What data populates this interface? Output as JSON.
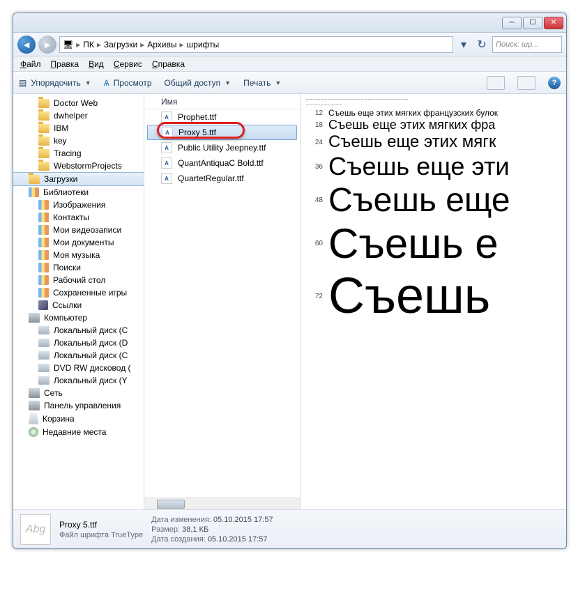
{
  "breadcrumb": {
    "pc": "ПК",
    "downloads": "Загрузки",
    "archives": "Архивы",
    "fonts": "шрифты"
  },
  "search": {
    "placeholder": "Поиск: шр..."
  },
  "menu": {
    "file": "Файл",
    "edit": "Правка",
    "view": "Вид",
    "tools": "Сервис",
    "help": "Справка"
  },
  "toolbar": {
    "organize": "Упорядочить",
    "preview": "Просмотр",
    "share": "Общий доступ",
    "print": "Печать"
  },
  "sidebar": {
    "items": [
      {
        "label": "Doctor Web",
        "icon": "f",
        "lvl": 2
      },
      {
        "label": "dwhelper",
        "icon": "f",
        "lvl": 2
      },
      {
        "label": "IBM",
        "icon": "f",
        "lvl": 2
      },
      {
        "label": "key",
        "icon": "f",
        "lvl": 2
      },
      {
        "label": "Tracing",
        "icon": "f",
        "lvl": 2
      },
      {
        "label": "WebstormProjects",
        "icon": "f",
        "lvl": 2
      },
      {
        "label": "Загрузки",
        "icon": "f",
        "lvl": 1,
        "sel": true
      },
      {
        "label": "Библиотеки",
        "icon": "lib",
        "lvl": 1
      },
      {
        "label": "Изображения",
        "icon": "lib",
        "lvl": 2
      },
      {
        "label": "Контакты",
        "icon": "lib",
        "lvl": 2
      },
      {
        "label": "Мои видеозаписи",
        "icon": "lib",
        "lvl": 2
      },
      {
        "label": "Мои документы",
        "icon": "lib",
        "lvl": 2
      },
      {
        "label": "Моя музыка",
        "icon": "lib",
        "lvl": 2
      },
      {
        "label": "Поиски",
        "icon": "lib",
        "lvl": 2
      },
      {
        "label": "Рабочий стол",
        "icon": "lib",
        "lvl": 2
      },
      {
        "label": "Сохраненные игры",
        "icon": "lib",
        "lvl": 2
      },
      {
        "label": "Ссылки",
        "icon": "link",
        "lvl": 2
      },
      {
        "label": "Компьютер",
        "icon": "pc",
        "lvl": 1
      },
      {
        "label": "Локальный диск (C",
        "icon": "drv",
        "lvl": 2
      },
      {
        "label": "Локальный диск (D",
        "icon": "drv",
        "lvl": 2
      },
      {
        "label": "Локальный диск (С",
        "icon": "drv",
        "lvl": 2
      },
      {
        "label": "DVD RW дисковод (",
        "icon": "drv",
        "lvl": 2
      },
      {
        "label": "Локальный диск (Y",
        "icon": "drv",
        "lvl": 2
      },
      {
        "label": "Сеть",
        "icon": "pc",
        "lvl": 1
      },
      {
        "label": "Панель управления",
        "icon": "pc",
        "lvl": 1
      },
      {
        "label": "Корзина",
        "icon": "rec",
        "lvl": 1
      },
      {
        "label": "Недавние места",
        "icon": "clock",
        "lvl": 1
      }
    ]
  },
  "filelist": {
    "header": "Имя",
    "items": [
      {
        "name": "Prophet.ttf"
      },
      {
        "name": "Proxy 5.ttf",
        "sel": true
      },
      {
        "name": "Public Utility Jeepney.ttf"
      },
      {
        "name": "QuantAntiquaC Bold.ttf"
      },
      {
        "name": "QuartetRegular.ttf"
      }
    ]
  },
  "preview": {
    "tiny1": "────────────────────────────",
    "tiny2": "────────── · · ·",
    "lines": [
      {
        "size": "12",
        "text": "Съешь еще этих мягких французских булок"
      },
      {
        "size": "18",
        "text": "Съешь еще этих мягких фра"
      },
      {
        "size": "24",
        "text": "Съешь еще этих мягк"
      },
      {
        "size": "36",
        "text": "Съешь еще эти"
      },
      {
        "size": "48",
        "text": "Съешь еще"
      },
      {
        "size": "60",
        "text": "Съешь е"
      },
      {
        "size": "72",
        "text": "Съешь"
      }
    ]
  },
  "details": {
    "filename": "Proxy 5.ttf",
    "filetype": "Файл шрифта TrueType",
    "iconText": "Abg",
    "modLabel": "Дата изменения:",
    "modVal": "05.10.2015 17:57",
    "sizeLabel": "Размер:",
    "sizeVal": "38,1 КБ",
    "createdLabel": "Дата создания:",
    "createdVal": "05.10.2015 17:57"
  }
}
